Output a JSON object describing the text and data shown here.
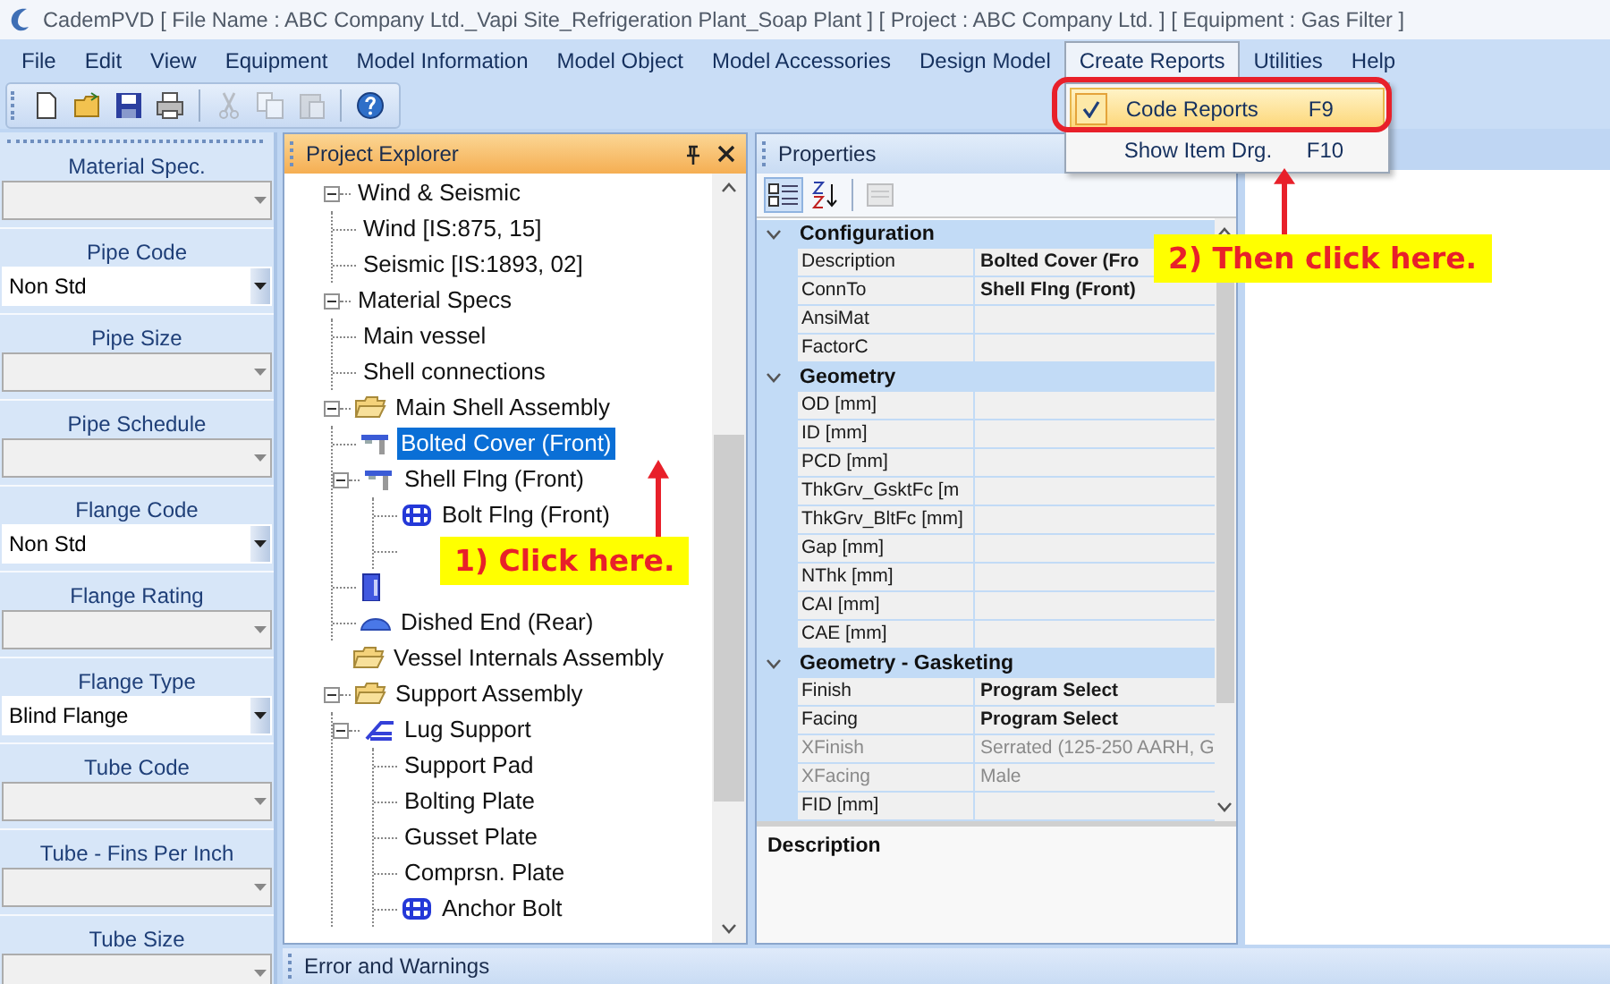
{
  "window": {
    "title": "CademPVD [ File Name : ABC Company Ltd._Vapi Site_Refrigeration Plant_Soap Plant ] [ Project : ABC Company Ltd. ] [ Equipment : Gas Filter ]"
  },
  "menus": [
    {
      "label": "File",
      "open": false
    },
    {
      "label": "Edit",
      "open": false
    },
    {
      "label": "View",
      "open": false
    },
    {
      "label": "Equipment",
      "open": false
    },
    {
      "label": "Model Information",
      "open": false
    },
    {
      "label": "Model Object",
      "open": false
    },
    {
      "label": "Model Accessories",
      "open": false
    },
    {
      "label": "Design Model",
      "open": false
    },
    {
      "label": "Create Reports",
      "open": true
    },
    {
      "label": "Utilities",
      "open": false
    },
    {
      "label": "Help",
      "open": false
    }
  ],
  "dropdown": [
    {
      "label": "Code Reports",
      "shortcut": "F9",
      "checked": true,
      "selected": true
    },
    {
      "label": "Show Item Drg.",
      "shortcut": "F10",
      "checked": false,
      "selected": false
    }
  ],
  "toolbar": [
    {
      "kind": "new",
      "disabled": false
    },
    {
      "kind": "open",
      "disabled": false
    },
    {
      "kind": "save",
      "disabled": false
    },
    {
      "kind": "print",
      "disabled": false
    },
    {
      "kind": "separator"
    },
    {
      "kind": "cut",
      "disabled": true
    },
    {
      "kind": "copy",
      "disabled": true
    },
    {
      "kind": "paste",
      "disabled": true
    },
    {
      "kind": "separator"
    },
    {
      "kind": "help",
      "disabled": false
    }
  ],
  "left_panel": [
    {
      "label": "Material Spec.",
      "disabled": true
    },
    {
      "label": "Pipe Code",
      "value": "Non Std",
      "disabled": false
    },
    {
      "label": "Pipe Size",
      "disabled": true
    },
    {
      "label": "Pipe Schedule",
      "disabled": true
    },
    {
      "label": "Flange Code",
      "value": "Non Std",
      "disabled": false
    },
    {
      "label": "Flange Rating",
      "disabled": true
    },
    {
      "label": "Flange Type",
      "value": "Blind Flange",
      "disabled": false
    },
    {
      "label": "Tube Code",
      "disabled": true
    },
    {
      "label": "Tube - Fins Per Inch",
      "disabled": true
    },
    {
      "label": "Tube Size",
      "disabled": true
    }
  ],
  "explorer": {
    "title": "Project Explorer",
    "tree": [
      {
        "label": "Wind & Seismic",
        "kind": "item",
        "expanded": true,
        "selected": false,
        "children": [
          {
            "label": "Wind [IS:875, 15]",
            "kind": "item",
            "selected": false
          },
          {
            "label": "Seismic [IS:1893, 02]",
            "kind": "item",
            "selected": false
          }
        ]
      },
      {
        "label": "Material Specs",
        "kind": "item",
        "expanded": true,
        "selected": false,
        "children": [
          {
            "label": "Main vessel",
            "kind": "item",
            "selected": false
          },
          {
            "label": "Shell connections",
            "kind": "item",
            "selected": false
          }
        ]
      },
      {
        "label": "Main Shell Assembly",
        "kind": "folder",
        "expanded": true,
        "selected": false,
        "children": [
          {
            "label": "Bolted Cover (Front)",
            "kind": "flange",
            "selected": true
          },
          {
            "label": "Shell Flng (Front)",
            "kind": "flange",
            "expanded": true,
            "selected": false,
            "children": [
              {
                "label": "Bolt Flng (Front)",
                "kind": "bolt",
                "selected": false
              },
              {
                "kind": "hidden"
              }
            ]
          },
          {
            "kind": "shell",
            "selected": false
          },
          {
            "label": "Dished End (Rear)",
            "kind": "dish",
            "selected": false
          }
        ]
      },
      {
        "label": "Vessel Internals Assembly",
        "kind": "folder",
        "selected": false
      },
      {
        "label": "Support Assembly",
        "kind": "folder",
        "expanded": true,
        "selected": false,
        "children": [
          {
            "label": "Lug Support",
            "kind": "lug",
            "expanded": true,
            "selected": false,
            "children": [
              {
                "label": "Support Pad",
                "kind": "item",
                "selected": false
              },
              {
                "label": "Bolting Plate",
                "kind": "item",
                "selected": false
              },
              {
                "label": "Gusset Plate",
                "kind": "item",
                "selected": false
              },
              {
                "label": "Comprsn. Plate",
                "kind": "item",
                "selected": false
              },
              {
                "label": "Anchor Bolt",
                "kind": "bolt",
                "selected": false
              }
            ]
          }
        ]
      }
    ]
  },
  "properties": {
    "title": "Properties",
    "categories": [
      {
        "name": "Configuration",
        "expanded": true,
        "rows": [
          {
            "name": "Description",
            "value": "Bolted Cover (Fro",
            "bold": true,
            "disabled": false
          },
          {
            "name": "ConnTo",
            "value": "Shell Flng (Front)",
            "bold": true,
            "disabled": false
          },
          {
            "name": "AnsiMat",
            "disabled": false
          },
          {
            "name": "FactorC",
            "disabled": false
          }
        ]
      },
      {
        "name": "Geometry",
        "expanded": true,
        "rows": [
          {
            "name": "OD [mm]",
            "disabled": false
          },
          {
            "name": "ID [mm]",
            "disabled": false
          },
          {
            "name": "PCD [mm]",
            "disabled": false
          },
          {
            "name": "ThkGrv_GsktFc [m",
            "disabled": false
          },
          {
            "name": "ThkGrv_BltFc [mm]",
            "disabled": false
          },
          {
            "name": "Gap [mm]",
            "disabled": false
          },
          {
            "name": "NThk [mm]",
            "disabled": false
          },
          {
            "name": "CAI [mm]",
            "disabled": false
          },
          {
            "name": "CAE [mm]",
            "disabled": false
          }
        ]
      },
      {
        "name": "Geometry - Gasketing",
        "expanded": true,
        "rows": [
          {
            "name": "Finish",
            "value": "Program Select",
            "bold": true,
            "disabled": false
          },
          {
            "name": "Facing",
            "value": "Program Select",
            "bold": true,
            "disabled": false
          },
          {
            "name": "XFinish",
            "value": "Serrated (125-250 AARH, G",
            "bold": false,
            "disabled": true
          },
          {
            "name": "XFacing",
            "value": "Male",
            "bold": false,
            "disabled": true
          },
          {
            "name": "FID [mm]",
            "disabled": false
          }
        ]
      }
    ],
    "description_title": "Description"
  },
  "error_panel": {
    "title": "Error and Warnings"
  },
  "annotations": [
    {
      "text": "1) Click here."
    },
    {
      "text": "2) Then click here."
    }
  ]
}
